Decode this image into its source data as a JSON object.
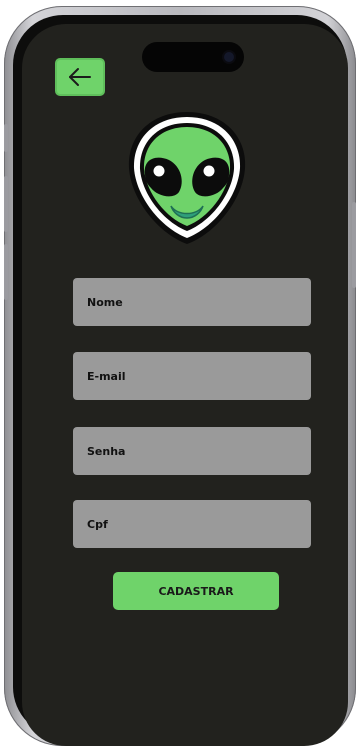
{
  "screen": {
    "background_color": "#22221e",
    "accent_color": "#6fd36a"
  },
  "header": {
    "back_icon": "arrow-left-icon"
  },
  "logo": {
    "icon": "alien-icon"
  },
  "form": {
    "fields": [
      {
        "label": "Nome"
      },
      {
        "label": "E-mail"
      },
      {
        "label": "Senha"
      },
      {
        "label": "Cpf"
      }
    ],
    "submit_label": "CADASTRAR"
  }
}
